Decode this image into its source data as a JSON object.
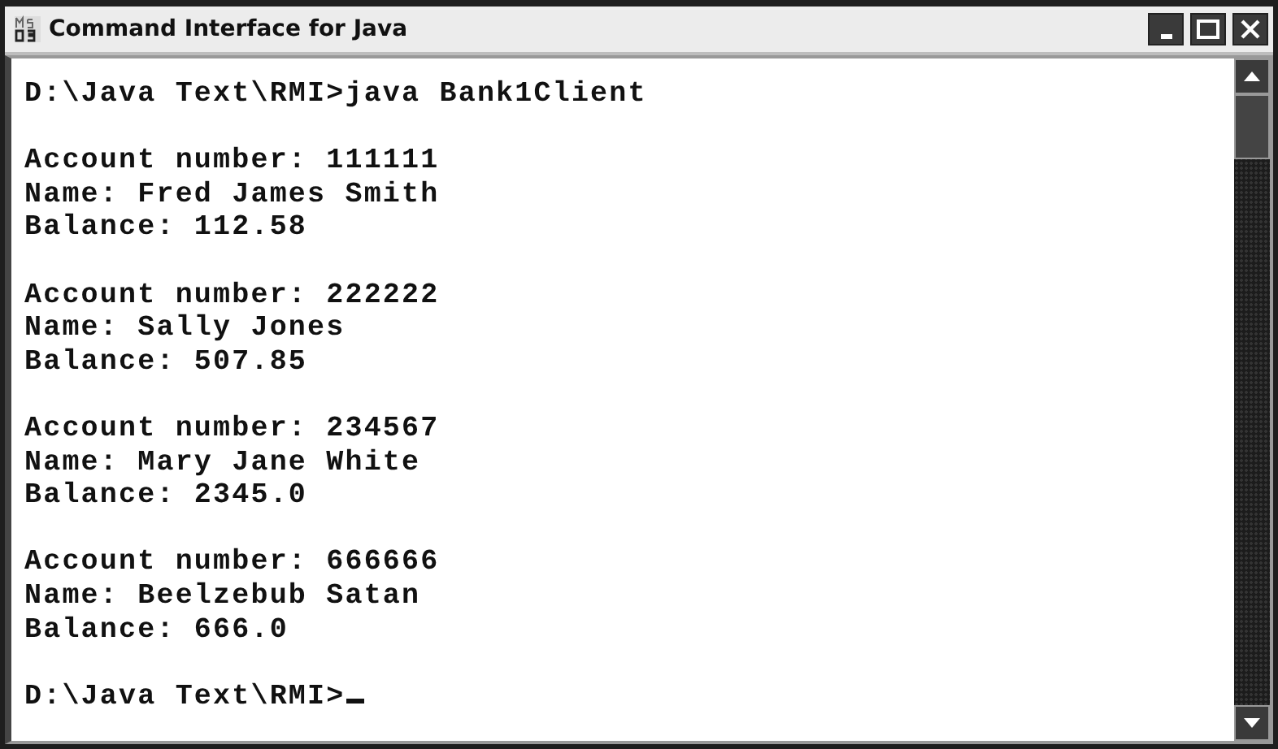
{
  "window": {
    "title": "Command Interface for Java"
  },
  "console": {
    "entries": [
      {
        "kind": "command",
        "text": "D:\\Java Text\\RMI>java Bank1Client"
      },
      {
        "kind": "record",
        "lines": [
          "Account number: 111111",
          "Name: Fred James Smith",
          "Balance: 112.58"
        ]
      },
      {
        "kind": "record",
        "lines": [
          "Account number: 222222",
          "Name: Sally Jones",
          "Balance: 507.85"
        ]
      },
      {
        "kind": "record",
        "lines": [
          "Account number: 234567",
          "Name: Mary Jane White",
          "Balance: 2345.0"
        ]
      },
      {
        "kind": "record",
        "lines": [
          "Account number: 666666",
          "Name: Beelzebub Satan",
          "Balance: 666.0"
        ]
      },
      {
        "kind": "prompt",
        "text": "D:\\Java Text\\RMI>",
        "cursor": true
      }
    ]
  }
}
